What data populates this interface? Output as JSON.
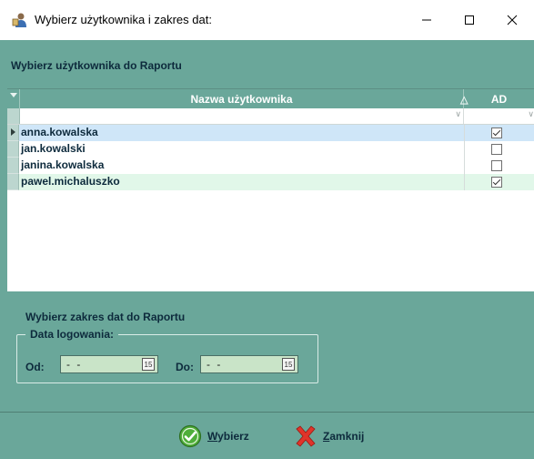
{
  "window": {
    "title": "Wybierz użytkownika i zakres dat:",
    "controls": {
      "minimize": "—",
      "maximize": "☐",
      "close": "✕"
    }
  },
  "users_panel": {
    "title": "Wybierz użytkownika do Raportu",
    "columns": {
      "name": "Nazwa użytkownika",
      "ad": "AD"
    },
    "sort_indicator": "△",
    "rows": [
      {
        "name": "anna.kowalska",
        "ad": true,
        "selected": true
      },
      {
        "name": "jan.kowalski",
        "ad": false
      },
      {
        "name": "janina.kowalska",
        "ad": false
      },
      {
        "name": "pawel.michaluszko",
        "ad": true
      }
    ]
  },
  "date_panel": {
    "title": "Wybierz zakres dat do Raportu",
    "group_label": "Data logowania:",
    "from_label": "Od:",
    "from_value": "- -",
    "to_label": "Do:",
    "to_value": "- -",
    "calendar_glyph": "15"
  },
  "buttons": {
    "select": {
      "mnemonic": "W",
      "rest": "ybierz"
    },
    "close": {
      "mnemonic": "Z",
      "rest": "amknij"
    }
  },
  "colors": {
    "panel_bg": "#6aa79a",
    "selected_row": "#cfe6f8",
    "alt_row": "#e1f7e9",
    "date_field": "#c9e4c8"
  }
}
